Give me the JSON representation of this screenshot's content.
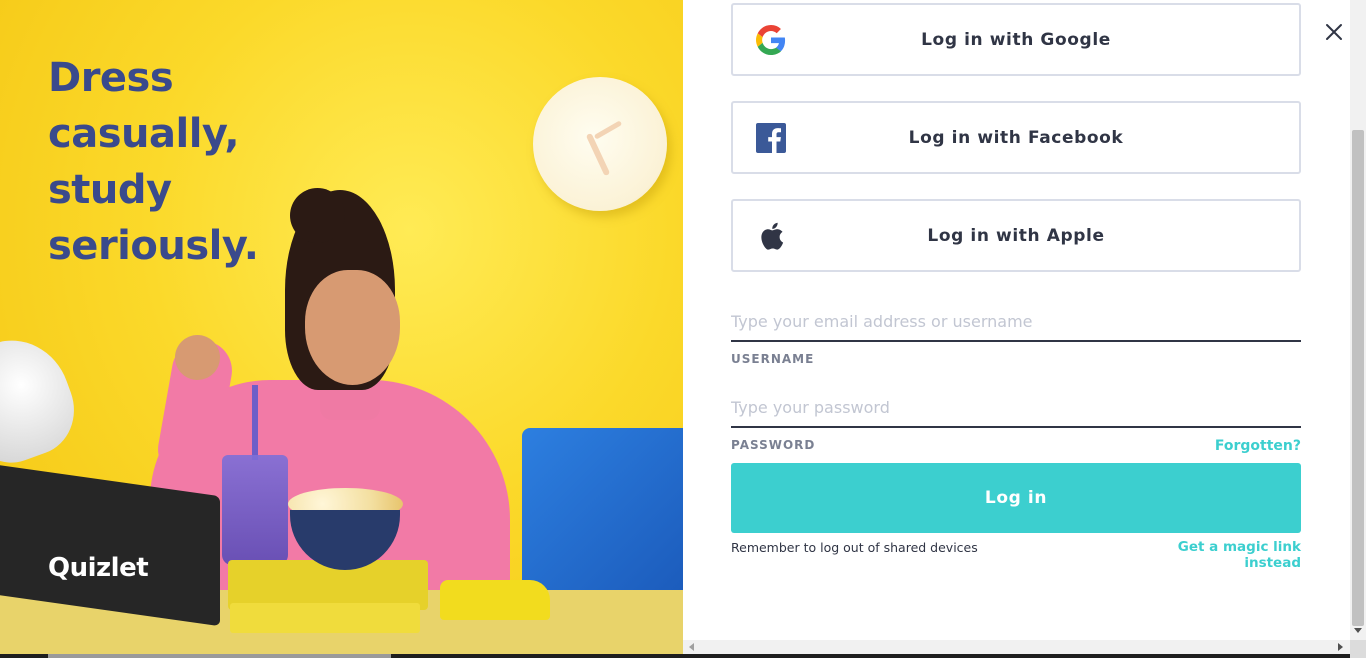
{
  "hero": {
    "headline": "Dress\ncasually,\nstudy\nseriously.",
    "brand": "Quizlet"
  },
  "social": {
    "google_label": "Log in with Google",
    "facebook_label": "Log in with Facebook",
    "apple_label": "Log in with Apple"
  },
  "form": {
    "username_placeholder": "Type your email address or username",
    "username_value": "",
    "username_label": "USERNAME",
    "password_placeholder": "Type your password",
    "password_value": "",
    "password_label": "PASSWORD",
    "forgot_link": "Forgotten?",
    "login_button": "Log in",
    "remember_text": "Remember to log out of shared devices",
    "magic_link": "Get a magic link instead"
  },
  "colors": {
    "accent": "#3ccfcf",
    "headline": "#3a4a8c",
    "text": "#303545",
    "border": "#d9dde8",
    "hero_bg": "#fbd92a"
  },
  "icons": {
    "close": "close-icon",
    "google": "google-icon",
    "facebook": "facebook-icon",
    "apple": "apple-icon"
  }
}
